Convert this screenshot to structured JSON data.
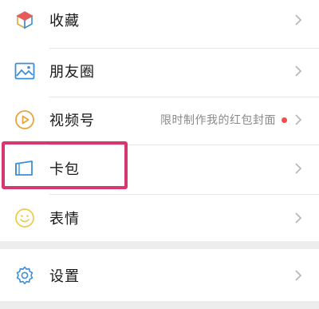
{
  "menu": {
    "items": [
      {
        "label": "收藏",
        "icon": "favorites-cube-icon"
      },
      {
        "label": "朋友圈",
        "icon": "moments-image-icon"
      },
      {
        "label": "视频号",
        "icon": "channels-play-icon",
        "subtitle": "限时制作我的红包封面",
        "badge": "red-dot"
      },
      {
        "label": "卡包",
        "icon": "card-wallet-icon"
      },
      {
        "label": "表情",
        "icon": "emoji-smiley-icon"
      }
    ],
    "settings": {
      "label": "设置",
      "icon": "settings-gear-icon"
    }
  },
  "colors": {
    "accent_blue": "#3d8ed6",
    "highlight": "#d63770",
    "badge_red": "#f14e4e",
    "cube_top": "#e65a5a",
    "smiley": "#f2c94c",
    "video": "#e8a33b"
  }
}
